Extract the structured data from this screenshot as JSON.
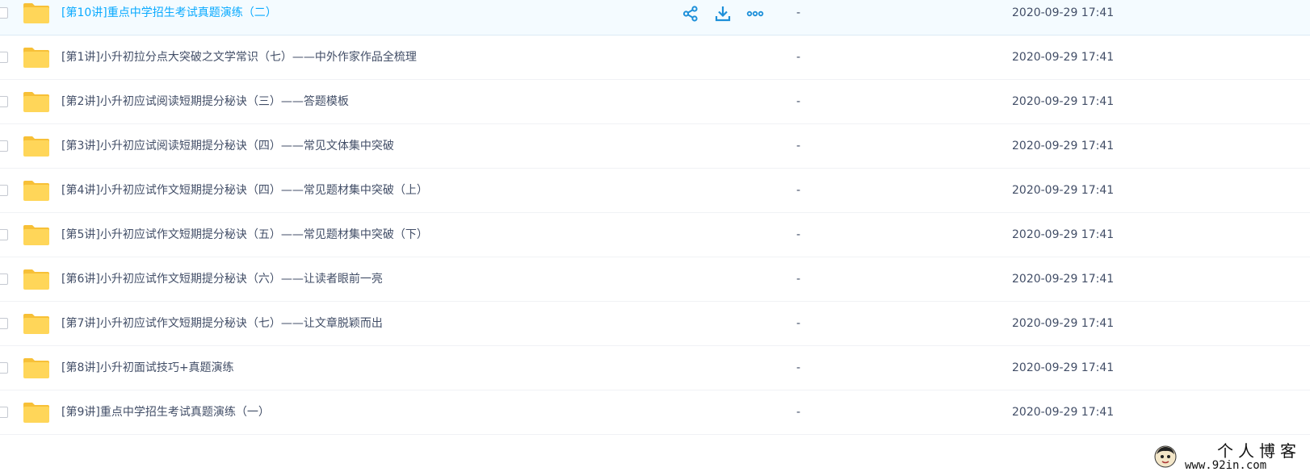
{
  "icons": {
    "checkbox": "checkbox-icon",
    "folder": "folder-icon",
    "share": "share-icon",
    "download": "download-icon",
    "more": "more-icon"
  },
  "colors": {
    "accent": "#09aaff",
    "action_icon": "#1c8fd9",
    "folder_body": "#ffd659",
    "folder_back": "#f7c037",
    "text": "#424e67",
    "hover_row_bg": "#f4fbff"
  },
  "files": [
    {
      "name": "[第10讲]重点中学招生考试真题演练（二）",
      "size": "-",
      "modified": "2020-09-29 17:41",
      "hovered": true
    },
    {
      "name": "[第1讲]小升初拉分点大突破之文学常识（七）——中外作家作品全梳理",
      "size": "-",
      "modified": "2020-09-29 17:41",
      "hovered": false
    },
    {
      "name": "[第2讲]小升初应试阅读短期提分秘诀（三）——答题模板",
      "size": "-",
      "modified": "2020-09-29 17:41",
      "hovered": false
    },
    {
      "name": "[第3讲]小升初应试阅读短期提分秘诀（四）——常见文体集中突破",
      "size": "-",
      "modified": "2020-09-29 17:41",
      "hovered": false
    },
    {
      "name": "[第4讲]小升初应试作文短期提分秘诀（四）——常见题材集中突破（上）",
      "size": "-",
      "modified": "2020-09-29 17:41",
      "hovered": false
    },
    {
      "name": "[第5讲]小升初应试作文短期提分秘诀（五）——常见题材集中突破（下）",
      "size": "-",
      "modified": "2020-09-29 17:41",
      "hovered": false
    },
    {
      "name": "[第6讲]小升初应试作文短期提分秘诀（六）——让读者眼前一亮",
      "size": "-",
      "modified": "2020-09-29 17:41",
      "hovered": false
    },
    {
      "name": "[第7讲]小升初应试作文短期提分秘诀（七）——让文章脱颖而出",
      "size": "-",
      "modified": "2020-09-29 17:41",
      "hovered": false
    },
    {
      "name": "[第8讲]小升初面试技巧+真题演练",
      "size": "-",
      "modified": "2020-09-29 17:41",
      "hovered": false
    },
    {
      "name": "[第9讲]重点中学招生考试真题演练（一）",
      "size": "-",
      "modified": "2020-09-29 17:41",
      "hovered": false
    }
  ],
  "watermark": {
    "title": "个人博客",
    "url": "www.92in.com"
  }
}
